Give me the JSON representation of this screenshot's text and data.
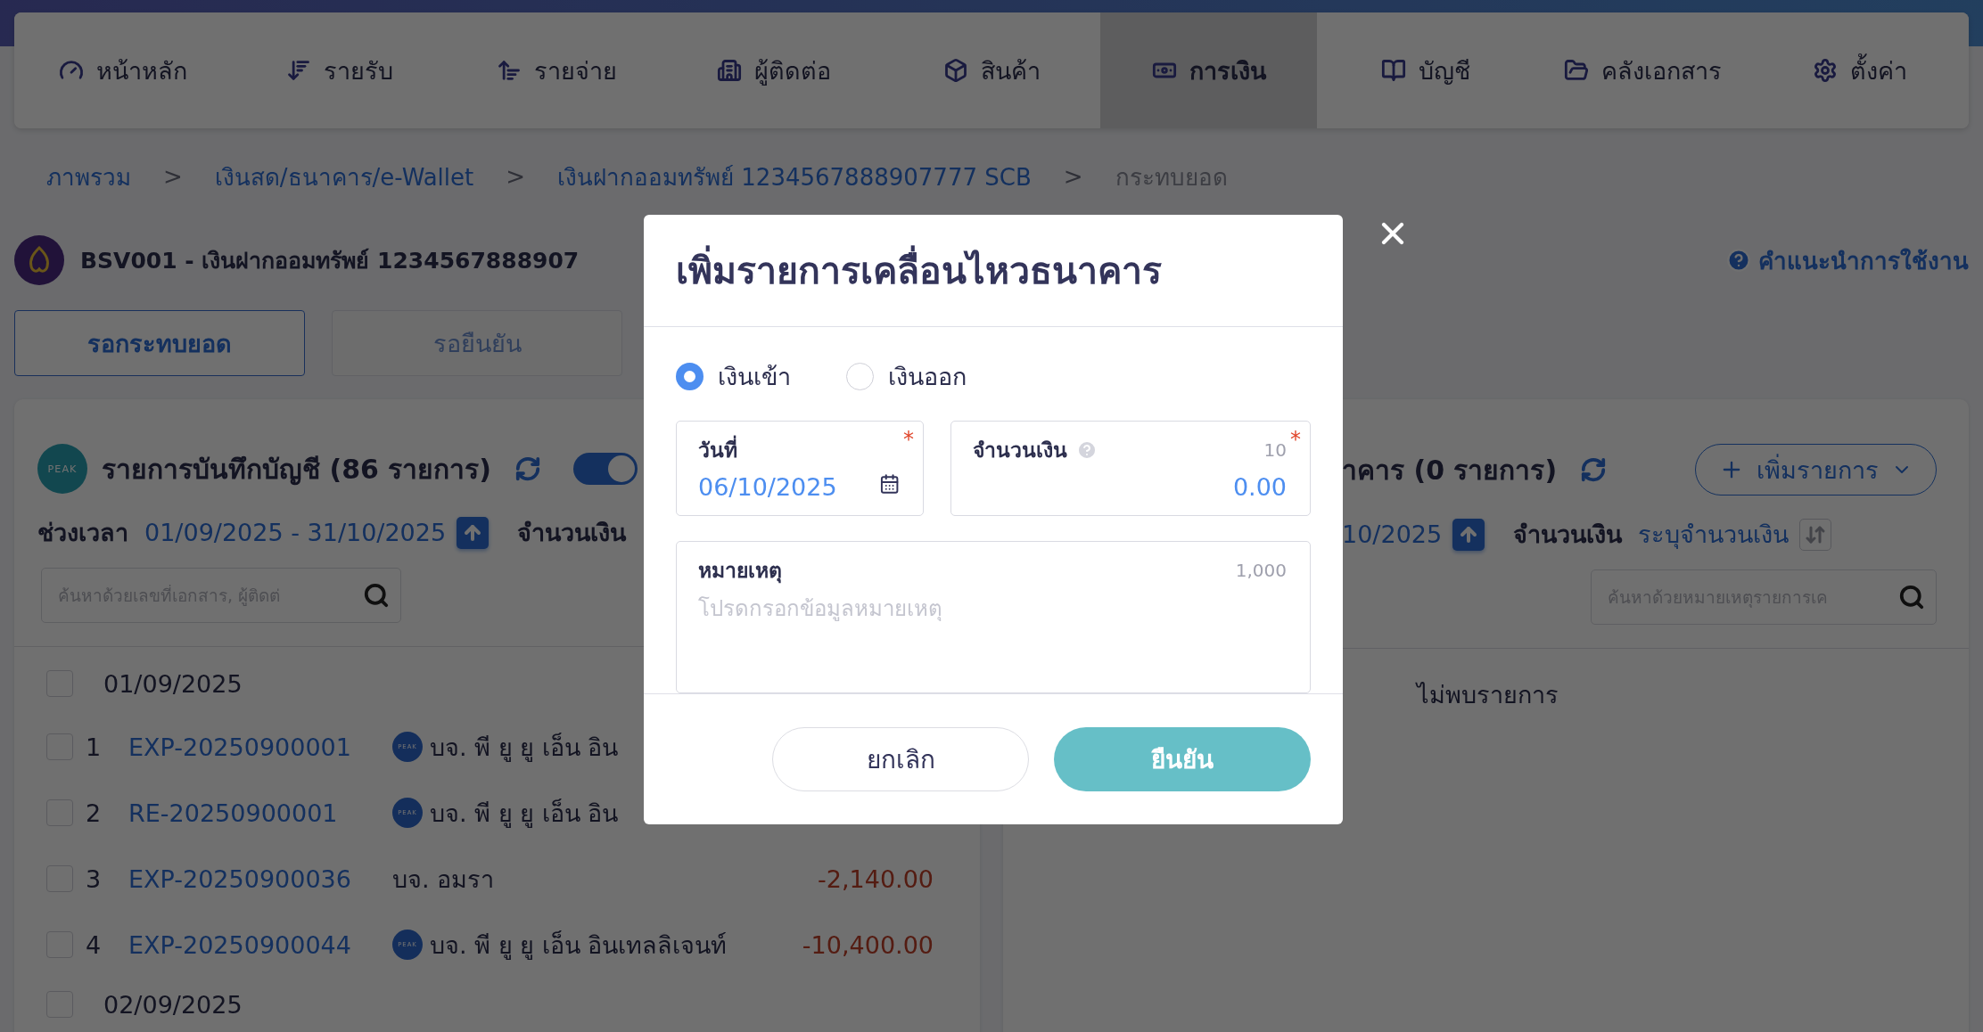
{
  "nav": [
    {
      "label": "หน้าหลัก",
      "selected": false
    },
    {
      "label": "รายรับ",
      "selected": false
    },
    {
      "label": "รายจ่าย",
      "selected": false
    },
    {
      "label": "ผู้ติดต่อ",
      "selected": false
    },
    {
      "label": "สินค้า",
      "selected": false
    },
    {
      "label": "การเงิน",
      "selected": true
    },
    {
      "label": "บัญชี",
      "selected": false
    },
    {
      "label": "คลังเอกสาร",
      "selected": false
    },
    {
      "label": "ตั้งค่า",
      "selected": false
    }
  ],
  "breadcrumb": [
    {
      "label": "ภาพรวม",
      "selected": false
    },
    {
      "separator": ">",
      "label": "เงินสด/ธนาคาร/e-Wallet",
      "selected": false
    },
    {
      "separator": ">",
      "label": "เงินฝากออมทรัพย์ 1234567888907777 SCB",
      "selected": false
    },
    {
      "separator": ">",
      "label": "กระทบยอด",
      "selected": true
    }
  ],
  "account": {
    "title": "BSV001 - เงินฝากออมทรัพย์ 1234567888907",
    "help": "คำแนะนำการใช้งาน"
  },
  "view_tabs": [
    {
      "label": "รอกระทบยอด",
      "selected": true
    },
    {
      "label": "รอยืนยัน",
      "selected": false
    }
  ],
  "left_panel": {
    "logo": "PEAK",
    "title": "รายการบันทึกบัญชี (86 รายการ)",
    "toggle_on": true,
    "period_label": "ช่วงเวลา",
    "period": "01/09/2025 - 31/10/2025",
    "amount_label": "จำนวนเงิน",
    "search_placeholder": "ค้นหาด้วยเลขที่เอกสาร, ผู้ติดต่",
    "groups": [
      {
        "date": "01/09/2025",
        "checked": false,
        "rows": [
          {
            "no": "1",
            "doc": "EXP-20250900001",
            "contact": "บจ. พี ยู ยู เอ็น อิน",
            "contact_logo": "PEAK",
            "checked": false
          },
          {
            "no": "2",
            "doc": "RE-20250900001",
            "contact": "บจ. พี ยู ยู เอ็น อิน",
            "contact_logo": "PEAK",
            "checked": false
          },
          {
            "no": "3",
            "doc": "EXP-20250900036",
            "contact": "บจ. อมรา",
            "amount": "-2,140.00",
            "checked": false
          },
          {
            "no": "4",
            "doc": "EXP-20250900044",
            "contact": "บจ. พี ยู ยู เอ็น อินเทลลิเจนท์",
            "contact_logo": "PEAK",
            "amount": "-10,400.00",
            "checked": false
          }
        ]
      },
      {
        "date": "02/09/2025",
        "checked": false
      }
    ]
  },
  "right_panel": {
    "title": "าคาร (0 รายการ)",
    "add_button": "เพิ่มรายการ",
    "period": "10/2025",
    "amount_label": "จำนวนเงิน",
    "amount_placeholder": "ระบุจำนวนเงิน",
    "search_placeholder": "ค้นหาด้วยหมายเหตุรายการเค",
    "empty": "ไม่พบรายการ"
  },
  "modal": {
    "title": "เพิ่มรายการเคลื่อนไหวธนาคาร",
    "types": [
      {
        "label": "เงินเข้า",
        "selected": true
      },
      {
        "label": "เงินออก",
        "selected": false
      }
    ],
    "date": {
      "label": "วันที่",
      "value": "06/10/2025",
      "required_mark": "*"
    },
    "amount": {
      "label": "จำนวนเงิน",
      "value": "0.00",
      "counter": "10",
      "required_mark": "*"
    },
    "note": {
      "label": "หมายเหตุ",
      "placeholder": "โปรดกรอกข้อมูลหมายเหตุ",
      "counter": "1,000"
    },
    "cancel": "ยกเลิก",
    "confirm": "ยืนยัน"
  }
}
